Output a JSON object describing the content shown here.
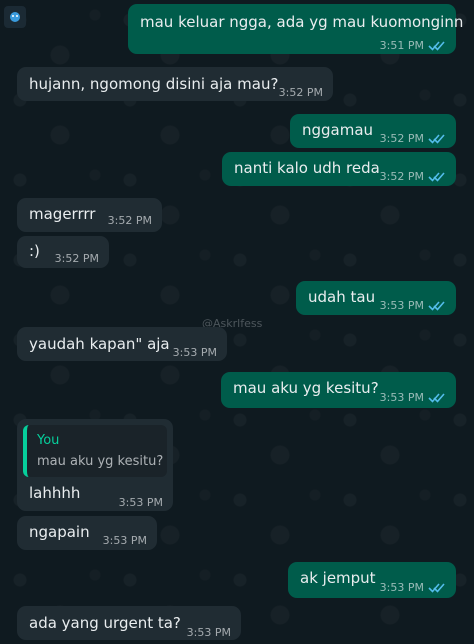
{
  "watermark": "@Askrlfess",
  "colors": {
    "outgoing_bubble": "#005c4b",
    "incoming_bubble": "#202c33",
    "read_ticks": "#53bdeb",
    "quote_accent": "#06cf9c"
  },
  "messages": [
    {
      "direction": "out",
      "text": "mau keluar ngga, ada yg mau kuomonginn",
      "time": "3:51 PM",
      "status": "read-ticks-icon"
    },
    {
      "direction": "in",
      "text": "hujann, ngomong disini aja mau?",
      "time": "3:52 PM"
    },
    {
      "direction": "out",
      "text": "nggamau",
      "time": "3:52 PM",
      "status": "read-ticks-icon"
    },
    {
      "direction": "out",
      "text": "nanti kalo udh reda",
      "time": "3:52 PM",
      "status": "read-ticks-icon"
    },
    {
      "direction": "in",
      "text": "magerrrr",
      "time": "3:52 PM"
    },
    {
      "direction": "in",
      "text": ":)",
      "time": "3:52 PM"
    },
    {
      "direction": "out",
      "text": "udah tau",
      "time": "3:53 PM",
      "status": "read-ticks-icon"
    },
    {
      "direction": "in",
      "text": "yaudah kapan\" aja",
      "time": "3:53 PM"
    },
    {
      "direction": "out",
      "text": "mau aku yg kesitu?",
      "time": "3:53 PM",
      "status": "read-ticks-icon"
    },
    {
      "direction": "in",
      "quote_author": "You",
      "quote_text": "mau aku yg kesitu?",
      "text": "lahhhh",
      "time": "3:53 PM"
    },
    {
      "direction": "in",
      "text": "ngapain",
      "time": "3:53 PM"
    },
    {
      "direction": "out",
      "text": "ak jemput",
      "time": "3:53 PM",
      "status": "read-ticks-icon"
    },
    {
      "direction": "in",
      "text": "ada yang urgent ta?",
      "time": "3:53 PM"
    }
  ]
}
